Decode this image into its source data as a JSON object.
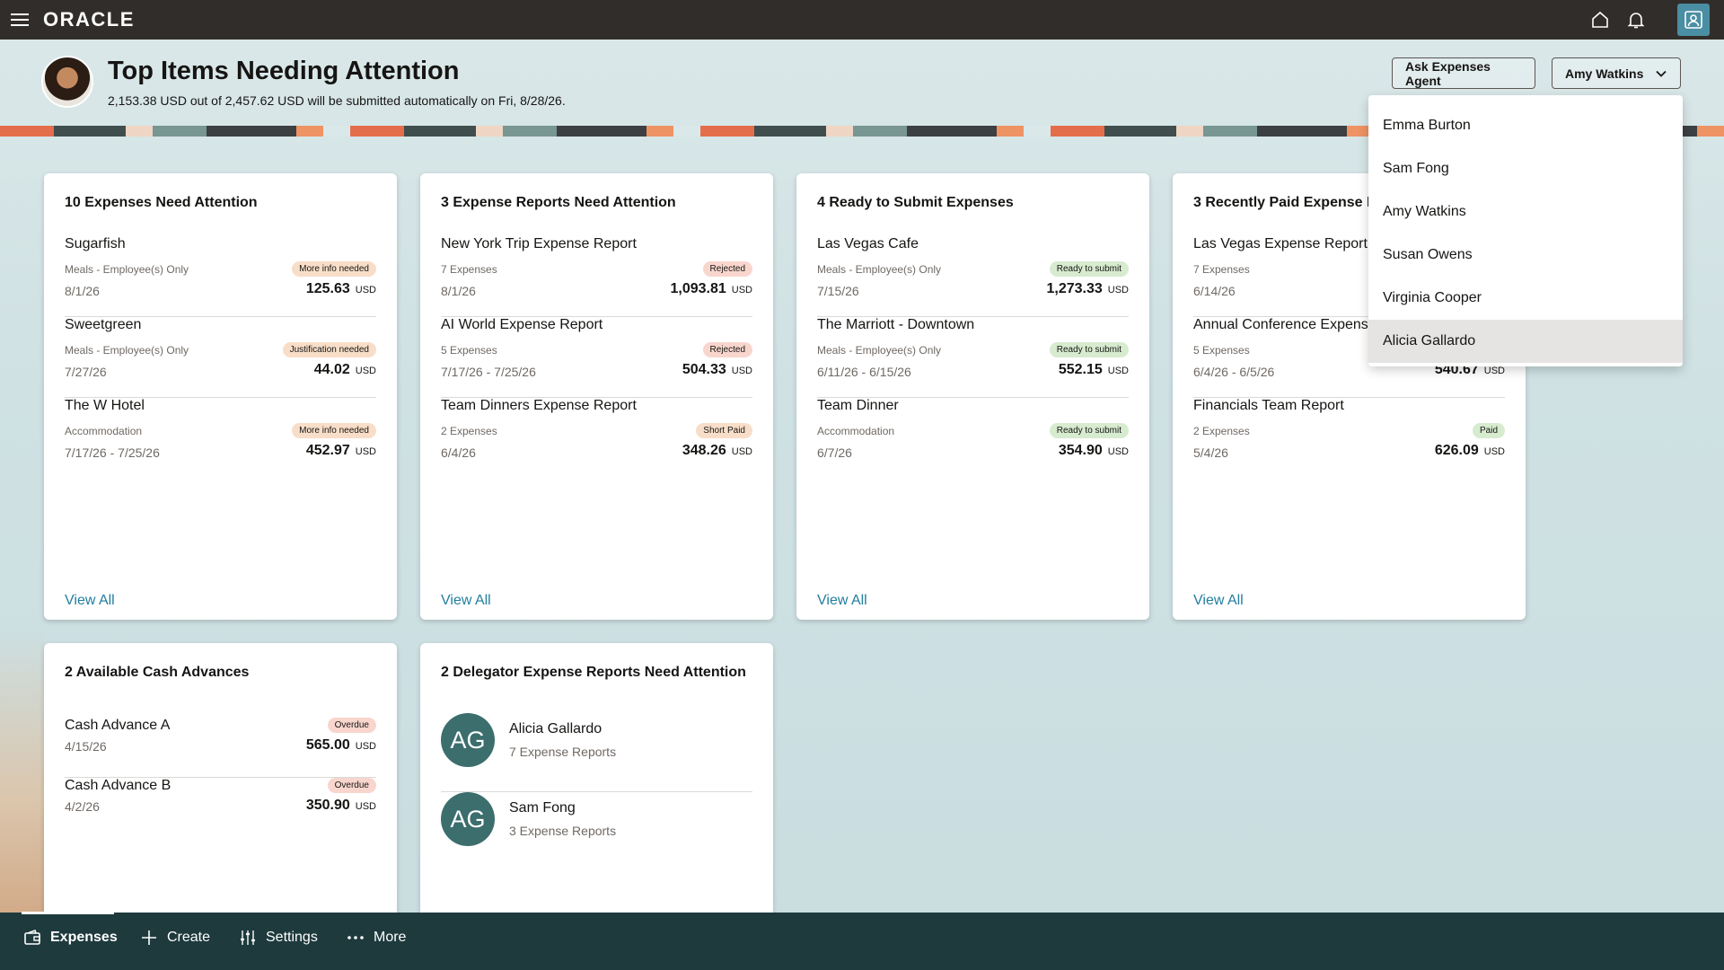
{
  "app": {
    "logo": "ORACLE",
    "page_title": "Top Items Needing Attention",
    "page_subtitle": "2,153.38 USD out of 2,457.62 USD will be submitted automatically on Fri, 8/28/26.",
    "ask_agent_label": "Ask Expenses Agent",
    "user_select_label": "Amy Watkins"
  },
  "dropdown": {
    "items": [
      "Emma Burton",
      "Sam Fong",
      "Amy Watkins",
      "Susan Owens",
      "Virginia Cooper",
      "Alicia Gallardo"
    ],
    "highlighted": "Alicia Gallardo"
  },
  "cards": {
    "expenses": {
      "title": "10 Expenses Need Attention",
      "rows": [
        {
          "name": "Sugarfish",
          "sub": "Meals - Employee(s) Only",
          "date": "8/1/26",
          "badge": "More info needed",
          "amount": "125.63",
          "currency": "USD"
        },
        {
          "name": "Sweetgreen",
          "sub": "Meals - Employee(s) Only",
          "date": "7/27/26",
          "badge": "Justification needed",
          "amount": "44.02",
          "currency": "USD"
        },
        {
          "name": "The W Hotel",
          "sub": "Accommodation",
          "date": "7/17/26 - 7/25/26",
          "badge": "More info needed",
          "amount": "452.97",
          "currency": "USD"
        }
      ],
      "view_all": "View All"
    },
    "reports": {
      "title": "3 Expense Reports Need Attention",
      "rows": [
        {
          "name": "New York Trip Expense Report",
          "sub": "7 Expenses",
          "date": "8/1/26",
          "badge": "Rejected",
          "amount": "1,093.81",
          "currency": "USD"
        },
        {
          "name": "AI World Expense Report",
          "sub": "5 Expenses",
          "date": "7/17/26 - 7/25/26",
          "badge": "Rejected",
          "amount": "504.33",
          "currency": "USD"
        },
        {
          "name": "Team Dinners Expense Report",
          "sub": "2 Expenses",
          "date": "6/4/26",
          "badge": "Short Paid",
          "amount": "348.26",
          "currency": "USD"
        }
      ],
      "view_all": "View All"
    },
    "ready": {
      "title": "4 Ready to Submit Expenses",
      "rows": [
        {
          "name": "Las Vegas Cafe",
          "sub": "Meals - Employee(s) Only",
          "date": "7/15/26",
          "badge": "Ready to submit",
          "amount": "1,273.33",
          "currency": "USD"
        },
        {
          "name": "The Marriott - Downtown",
          "sub": "Meals - Employee(s) Only",
          "date": "6/11/26 - 6/15/26",
          "badge": "Ready to submit",
          "amount": "552.15",
          "currency": "USD"
        },
        {
          "name": "Team Dinner",
          "sub": "Accommodation",
          "date": "6/7/26",
          "badge": "Ready to submit",
          "amount": "354.90",
          "currency": "USD"
        }
      ],
      "view_all": "View All"
    },
    "paid": {
      "title": "3 Recently Paid Expense F",
      "rows": [
        {
          "name": "Las Vegas Expense Report",
          "sub": "7 Expenses",
          "date": "6/14/26",
          "badge": "",
          "amount": "",
          "currency": ""
        },
        {
          "name": "Annual Conference Expens",
          "sub": "5 Expenses",
          "date": "6/4/26 - 6/5/26",
          "badge": "",
          "amount": "540.67",
          "currency": "USD"
        },
        {
          "name": "Financials Team Report",
          "sub": "2 Expenses",
          "date": "5/4/26",
          "badge": "Paid",
          "amount": "626.09",
          "currency": "USD"
        }
      ],
      "view_all": "View All"
    },
    "cash": {
      "title": "2 Available Cash Advances",
      "rows": [
        {
          "name": "Cash Advance A",
          "date": "4/15/26",
          "badge": "Overdue",
          "amount": "565.00",
          "currency": "USD"
        },
        {
          "name": "Cash Advance B",
          "date": "4/2/26",
          "badge": "Overdue",
          "amount": "350.90",
          "currency": "USD"
        }
      ]
    },
    "delegator": {
      "title": "2 Delegator Expense Reports Need Attention",
      "rows": [
        {
          "initials": "AG",
          "name": "Alicia Gallardo",
          "sub": "7 Expense Reports"
        },
        {
          "initials": "AG",
          "name": "Sam Fong",
          "sub": "3 Expense Reports"
        }
      ]
    }
  },
  "bottom_nav": {
    "expenses": "Expenses",
    "create": "Create",
    "settings": "Settings",
    "more": "More"
  },
  "colors": {
    "topbar": "#312d2a",
    "bottombar": "#1e3a3d",
    "link": "#227e9e",
    "avatar": "#3c6e6e"
  }
}
